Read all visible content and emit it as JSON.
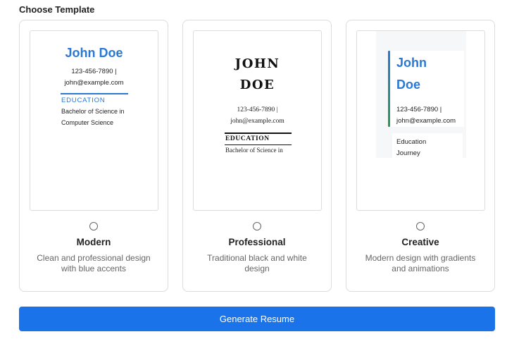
{
  "section": {
    "title": "Choose Template"
  },
  "templates": [
    {
      "name": "Modern",
      "description": "Clean and professional design with blue accents",
      "selected": false,
      "preview": {
        "name": "John Doe",
        "phone": "123-456-7890 |",
        "email": "john@example.com",
        "section_heading": "EDUCATION",
        "degree": "Bachelor of Science in Computer Science"
      }
    },
    {
      "name": "Professional",
      "description": "Traditional black and white design",
      "selected": false,
      "preview": {
        "name": "JOHN DOE",
        "phone": "123-456-7890 |",
        "email": "john@example.com",
        "section_heading": "EDUCATION",
        "degree": "Bachelor of Science in"
      }
    },
    {
      "name": "Creative",
      "description": "Modern design with gradients and animations",
      "selected": false,
      "preview": {
        "name": "John Doe",
        "phone": "123-456-7890 |",
        "email": "john@example.com",
        "section_heading": "Education",
        "degree": "Journey"
      }
    }
  ],
  "actions": {
    "generate_label": "Generate Resume"
  },
  "colors": {
    "accent": "#1a73e8",
    "modern_blue": "#2a78d4",
    "creative_green": "#2c9a56"
  }
}
